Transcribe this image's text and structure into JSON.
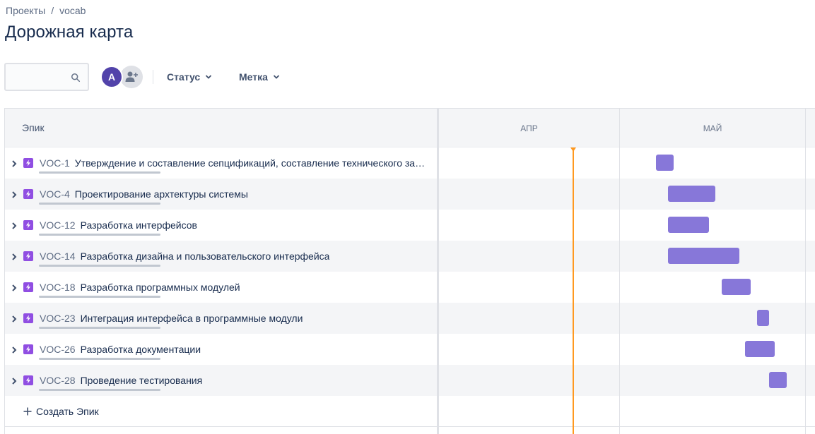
{
  "breadcrumb": {
    "project": "Проекты",
    "separator": "/",
    "current": "vocab"
  },
  "page_title": "Дорожная карта",
  "search": {
    "placeholder": ""
  },
  "avatar": {
    "initial": "A",
    "color": "#5243aa"
  },
  "filters": {
    "status": "Статус",
    "label": "Метка"
  },
  "table": {
    "column_header": "Эпик",
    "months": [
      "АПР",
      "МАЙ"
    ],
    "create_label": "Создать Эпик",
    "epics": [
      {
        "key": "VOC-1",
        "summary": "Утверждение и составление сепцификаций, составление технического зада...",
        "bar_start_day": "2024-05-07",
        "bar_end_day": "2024-05-09"
      },
      {
        "key": "VOC-4",
        "summary": "Проектирование архтектуры системы",
        "bar_start_day": "2024-05-09",
        "bar_end_day": "2024-05-16"
      },
      {
        "key": "VOC-12",
        "summary": "Разработка интерфейсов",
        "bar_start_day": "2024-05-09",
        "bar_end_day": "2024-05-15"
      },
      {
        "key": "VOC-14",
        "summary": "Разработка дизайна и пользовательского интерфейса",
        "bar_start_day": "2024-05-09",
        "bar_end_day": "2024-05-20"
      },
      {
        "key": "VOC-18",
        "summary": "Разработка программных модулей",
        "bar_start_day": "2024-05-18",
        "bar_end_day": "2024-05-22"
      },
      {
        "key": "VOC-23",
        "summary": "Интеграция интерфейса в программные модули",
        "bar_start_day": "2024-05-24",
        "bar_end_day": "2024-05-25"
      },
      {
        "key": "VOC-26",
        "summary": "Разработка документации",
        "bar_start_day": "2024-05-22",
        "bar_end_day": "2024-05-26"
      },
      {
        "key": "VOC-28",
        "summary": "Проведение тестирования",
        "bar_start_day": "2024-05-26",
        "bar_end_day": "2024-05-28"
      }
    ]
  },
  "colors": {
    "epic_icon": "#904ee2",
    "bar": "#8777d9",
    "today": "#ff991f"
  }
}
